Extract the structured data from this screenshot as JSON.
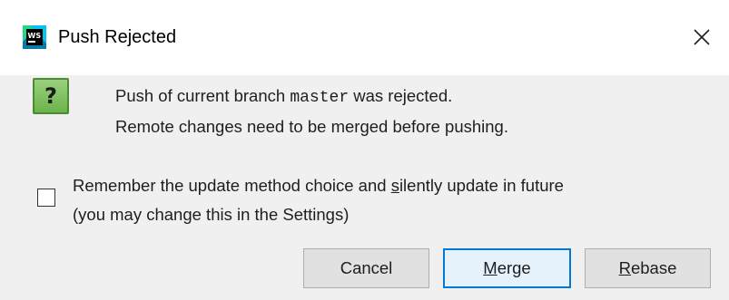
{
  "window": {
    "title": "Push Rejected",
    "app_icon_label": "WS",
    "close_glyph": "×"
  },
  "message": {
    "line1_prefix": "Push of current branch ",
    "branch": "master",
    "line1_suffix": " was rejected.",
    "line2": "Remote changes need to be merged before pushing.",
    "icon_glyph": "?"
  },
  "remember": {
    "checked": false,
    "line1_before": "Remember the update method choice and ",
    "line1_mnemonic": "s",
    "line1_after": "ilently update in future",
    "line2": "(you may change this in the Settings)"
  },
  "buttons": {
    "cancel": "Cancel",
    "merge_mnemonic": "M",
    "merge_rest": "erge",
    "rebase_mnemonic": "R",
    "rebase_rest": "ebase"
  },
  "colors": {
    "accent": "#0078d7",
    "dialog_bg": "#f0f0f0",
    "question_icon": "#6cb24a"
  }
}
